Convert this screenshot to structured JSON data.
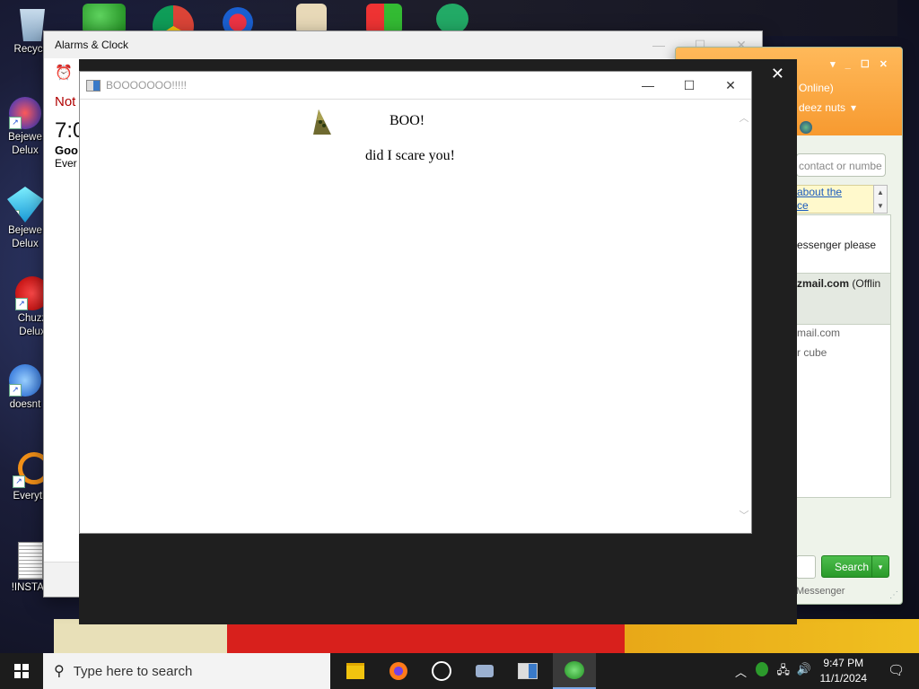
{
  "desktop": {
    "icons": [
      {
        "label": "Recycle"
      },
      {
        "label": "Bejewe\nDelux"
      },
      {
        "label": "Bejewe\nDelux"
      },
      {
        "label": "Chuzz\nDelux"
      },
      {
        "label": "doesnt"
      },
      {
        "label": "Everyth"
      },
      {
        "label": "!INSTAL"
      }
    ]
  },
  "alarms": {
    "title": "Alarms & Clock",
    "notice": "Not",
    "time": "7:0",
    "alarm_name": "Goo",
    "repeat": "Ever"
  },
  "dark_window": {
    "close_label": "✕"
  },
  "boo_dialog": {
    "title": "BOOOOOOO!!!!!",
    "heading": "BOO!",
    "message": "did I scare you!",
    "minimize": "—",
    "maximize": "☐",
    "close": "✕"
  },
  "messenger": {
    "status": "Online)",
    "personal_message": "deez nuts",
    "search_placeholder": "contact or numbe",
    "ad_line1": "about the",
    "ad_line2": "ce",
    "notice_text": "essenger please",
    "contact1_email": "zmail.com",
    "contact1_status": "(Offlin",
    "contact2_email": "mail.com",
    "contact2_note": "r cube",
    "search_button": "Search",
    "footer": "Messenger"
  },
  "taskbar": {
    "search_placeholder": "Type here to search",
    "time": "9:47 PM",
    "date": "11/1/2024"
  },
  "colors": {
    "accent": "#f79a30",
    "search_green": "#2a9a2a",
    "alarm_red": "#b00000"
  }
}
